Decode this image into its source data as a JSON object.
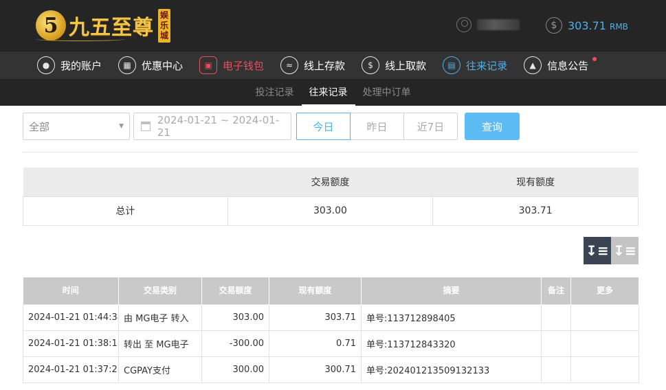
{
  "brand": {
    "logo_number": "5",
    "logo_text": "九五至尊",
    "badge": [
      "娱",
      "乐",
      "城"
    ]
  },
  "account": {
    "balance": "303.71",
    "currency": "RMB"
  },
  "nav": [
    {
      "label": "我的账户",
      "icon": "user-icon"
    },
    {
      "label": "优惠中心",
      "icon": "gift-icon"
    },
    {
      "label": "电子钱包",
      "icon": "wallet-icon"
    },
    {
      "label": "线上存款",
      "icon": "deposit-icon"
    },
    {
      "label": "线上取款",
      "icon": "withdraw-icon"
    },
    {
      "label": "往来记录",
      "icon": "records-icon"
    },
    {
      "label": "信息公告",
      "icon": "bell-icon"
    }
  ],
  "subnav": [
    {
      "label": "投注记录"
    },
    {
      "label": "往来记录"
    },
    {
      "label": "处理中订单"
    }
  ],
  "filters": {
    "type_selected": "全部",
    "date_range": "2024-01-21 ~ 2024-01-21",
    "quick": [
      "今日",
      "昨日",
      "近7日"
    ],
    "query_label": "查询"
  },
  "summary": {
    "headers": [
      "",
      "交易额度",
      "现有额度"
    ],
    "row": [
      "总计",
      "303.00",
      "303.71"
    ]
  },
  "records": {
    "headers": [
      "时间",
      "交易类别",
      "交易额度",
      "现有额度",
      "摘要",
      "备注",
      "更多"
    ],
    "rows": [
      [
        "2024-01-21 01:44:38",
        "由 MG电子 转入",
        "303.00",
        "303.71",
        "单号:113712898405",
        "",
        ""
      ],
      [
        "2024-01-21 01:38:13",
        "转出 至 MG电子",
        "-300.00",
        "0.71",
        "单号:113712843320",
        "",
        ""
      ],
      [
        "2024-01-21 01:37:27",
        "CGPAY支付",
        "300.00",
        "300.71",
        "单号:202401213509132133",
        "",
        ""
      ]
    ]
  },
  "colors": {
    "accent_blue": "#4fb0ea",
    "accent_red": "#ec4d5c",
    "header_bg": "#252525",
    "nav_bg": "#333333",
    "gold": "#f3c54a"
  }
}
